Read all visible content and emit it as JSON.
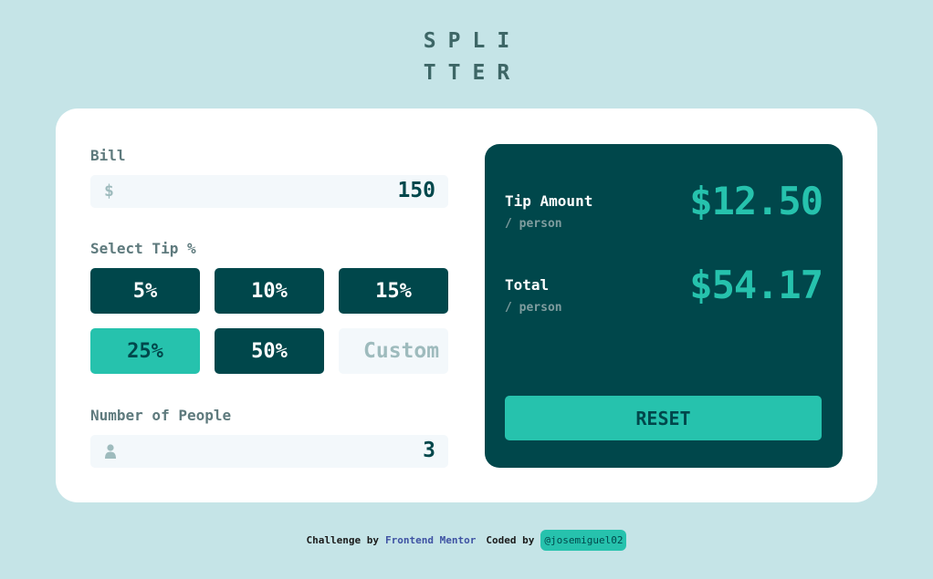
{
  "logo": {
    "line1": "SPLI",
    "line2": "TTER"
  },
  "bill": {
    "label": "Bill",
    "currency_symbol": "$",
    "value": "150"
  },
  "tip": {
    "label": "Select Tip %",
    "options": [
      "5%",
      "10%",
      "15%",
      "25%",
      "50%"
    ],
    "selected": "25%",
    "custom_placeholder": "Custom"
  },
  "people": {
    "label": "Number of People",
    "value": "3"
  },
  "results": {
    "tip_label": "Tip Amount",
    "tip_sub": "/ person",
    "tip_amount": "$12.50",
    "total_label": "Total",
    "total_sub": "/ person",
    "total_amount": "$54.17",
    "reset_label": "RESET"
  },
  "footer": {
    "challenge_text": "Challenge by",
    "challenge_link": "Frontend Mentor",
    "coded_text": "Coded by",
    "author_handle": "@josemiguel02"
  },
  "colors": {
    "background": "#c5e4e7",
    "dark_cyan": "#00474b",
    "strong_cyan": "#26c2ad",
    "input_bg": "#f3f8fb"
  },
  "icons": {
    "bill": "dollar-icon",
    "people": "person-icon"
  }
}
